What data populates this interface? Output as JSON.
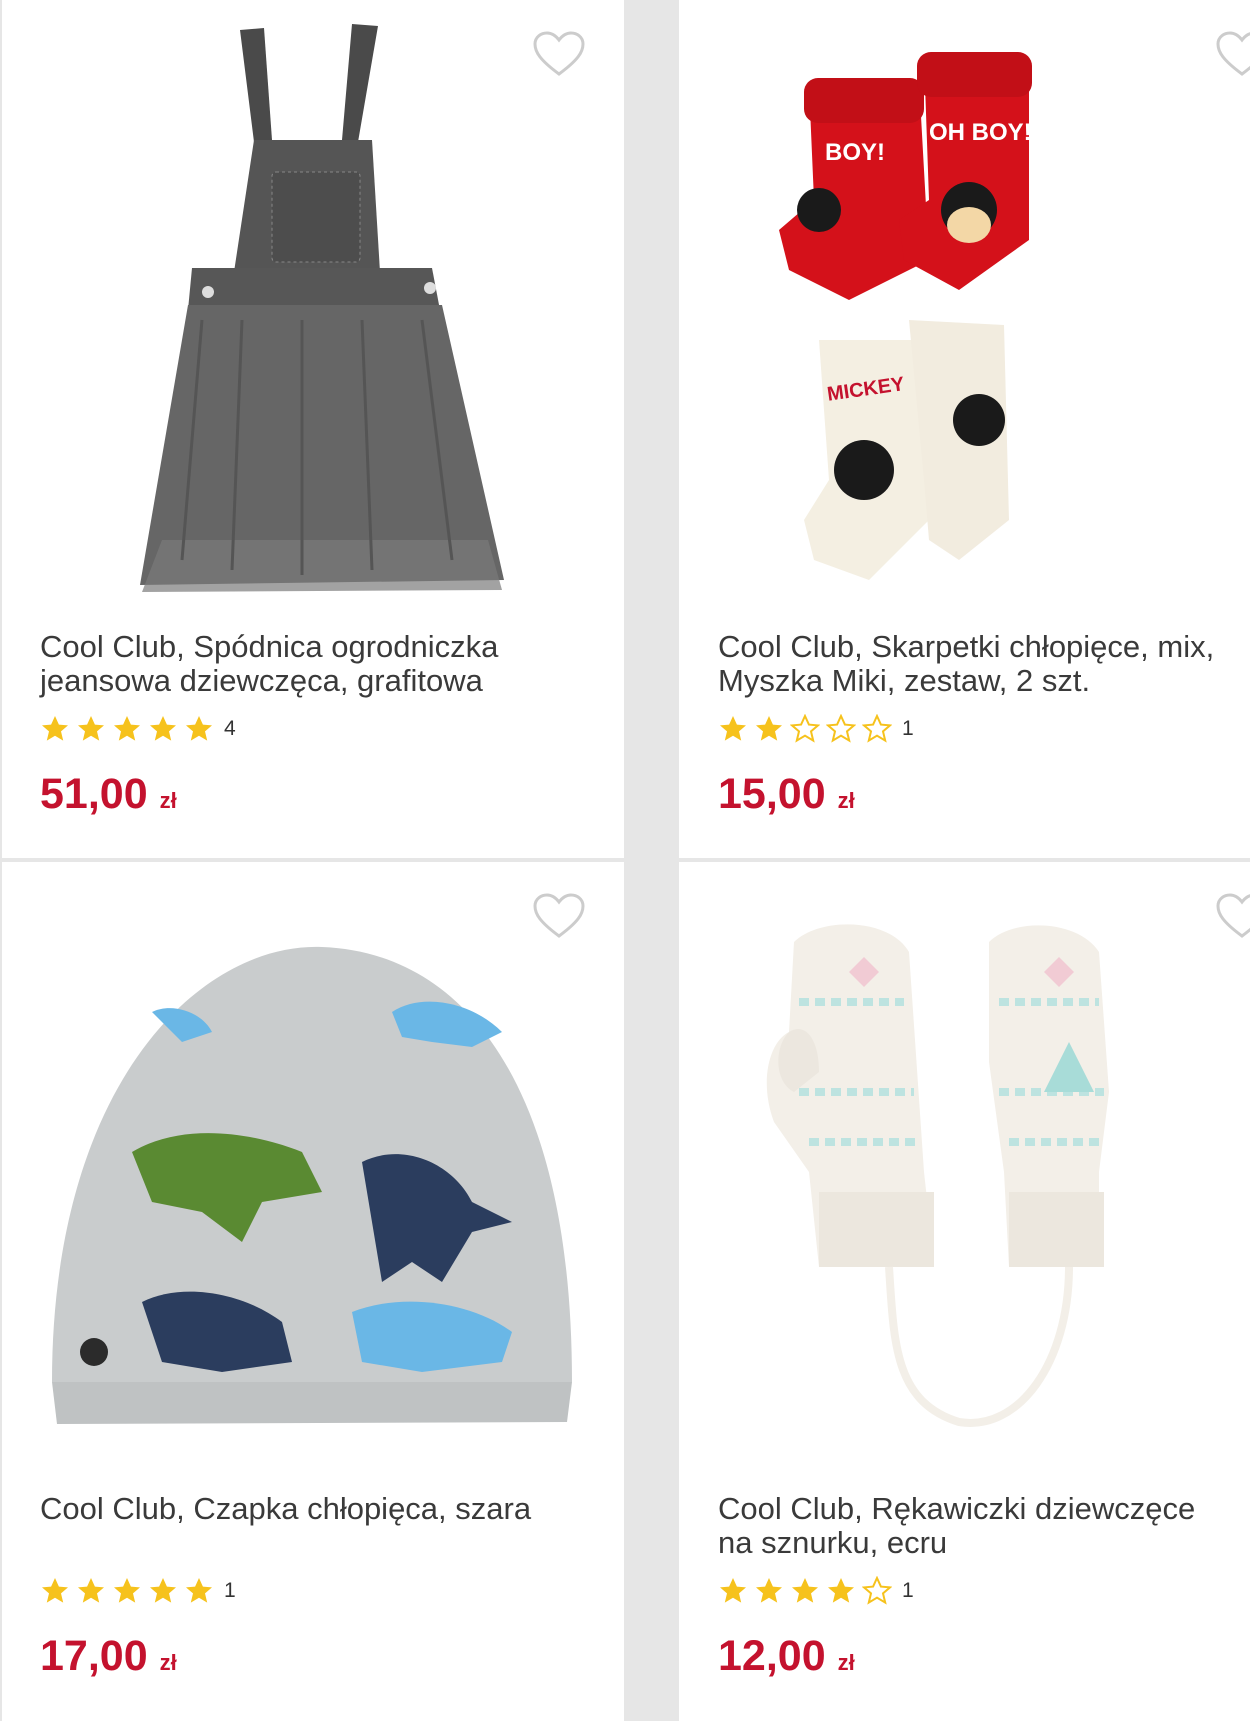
{
  "products": [
    {
      "title_line1": "Cool Club, Spódnica ogrodniczka",
      "title_line2": "jeansowa dziewczęca, grafitowa",
      "rating": 5,
      "rating_count": "4",
      "price": "51,00",
      "currency": "zł",
      "image_icon": "denim-pinafore-dress-image"
    },
    {
      "title_line1": "Cool Club, Skarpetki chłopięce, mix,",
      "title_line2": "Myszka Miki, zestaw, 2 szt.",
      "rating": 2,
      "rating_count": "1",
      "price": "15,00",
      "currency": "zł",
      "image_icon": "mickey-socks-image"
    },
    {
      "title_line1": "Cool Club, Czapka chłopięca, szara",
      "title_line2": "",
      "rating": 5,
      "rating_count": "1",
      "price": "17,00",
      "currency": "zł",
      "image_icon": "dino-beanie-image"
    },
    {
      "title_line1": "Cool Club, Rękawiczki dziewczęce",
      "title_line2": "na sznurku, ecru",
      "rating": 4,
      "rating_count": "1",
      "price": "12,00",
      "currency": "zł",
      "image_icon": "knit-mittens-image"
    }
  ],
  "colors": {
    "price": "#c4122e",
    "star_filled": "#f6c21c",
    "star_empty": "#f6c21c",
    "heart_outline": "#cccccc",
    "title_text": "#3a3a3a",
    "background": "#e6e6e6"
  },
  "icons": {
    "favorite": "heart-outline-icon",
    "star_full": "star-filled-icon",
    "star_empty": "star-outline-icon"
  }
}
